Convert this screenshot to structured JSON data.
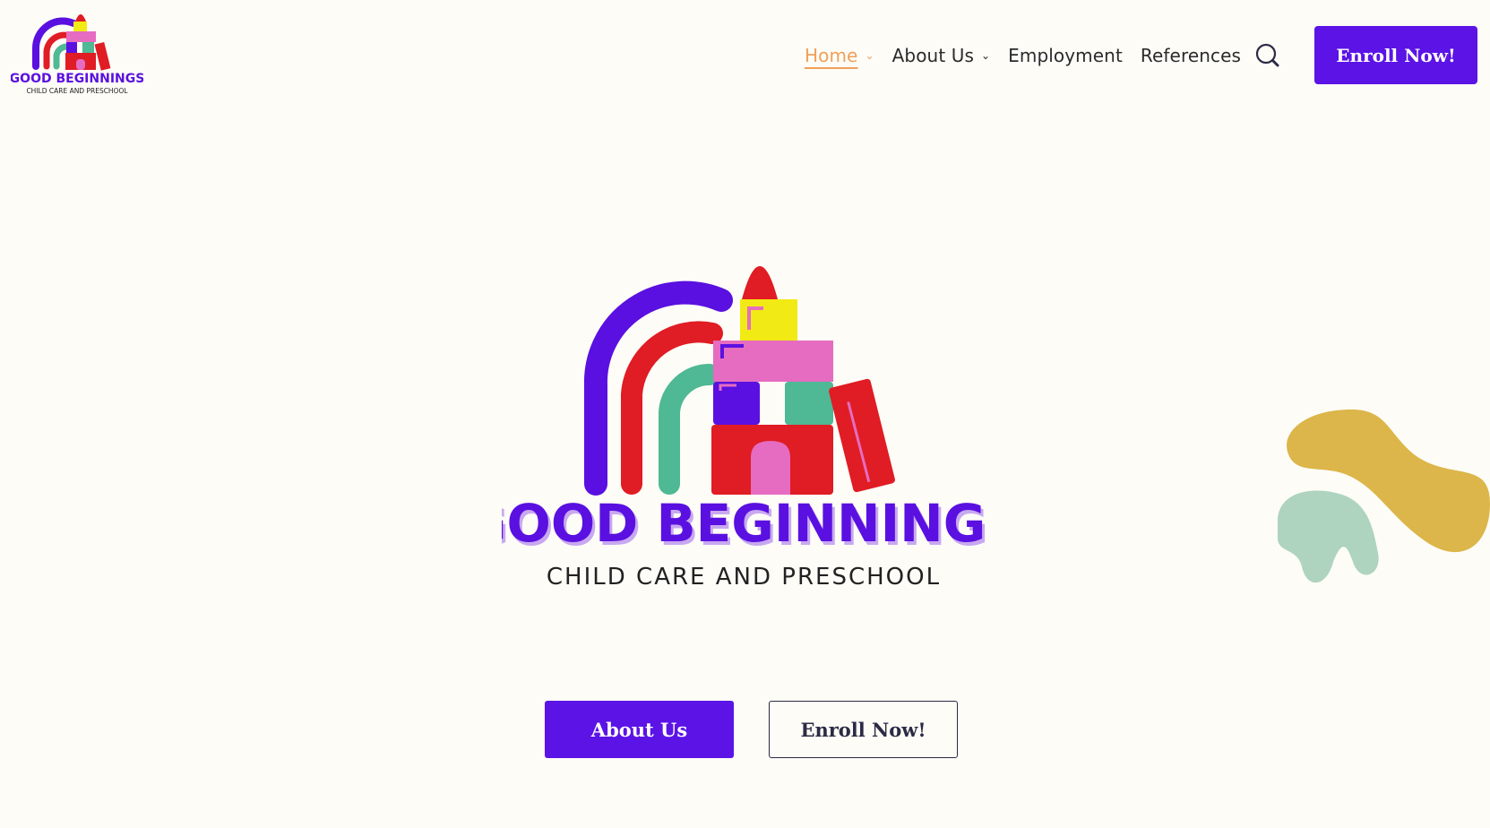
{
  "header": {
    "logo": {
      "title": "GOOD BEGINNINGS",
      "subtitle": "CHILD CARE AND PRESCHOOL"
    },
    "nav": [
      {
        "label": "Home",
        "active": true,
        "has_dropdown": true
      },
      {
        "label": "About Us",
        "active": false,
        "has_dropdown": true
      },
      {
        "label": "Employment",
        "active": false,
        "has_dropdown": false
      },
      {
        "label": "References",
        "active": false,
        "has_dropdown": false
      }
    ],
    "search_icon": "search-icon",
    "enroll_button": "Enroll Now!"
  },
  "hero": {
    "logo": {
      "title": "GOOD BEGINNINGS",
      "subtitle": "CHILD CARE AND PRESCHOOL"
    },
    "buttons": {
      "about": "About Us",
      "enroll": "Enroll Now!"
    }
  },
  "colors": {
    "background": "#fdfcf7",
    "primary": "#5b13e6",
    "accent_active": "#f0a05a",
    "text": "#2b2b2b",
    "blob_gold": "#dcb64a",
    "blob_mint": "#aed3bf",
    "logo_red": "#e01c24",
    "logo_purple": "#5a10e0",
    "logo_green": "#4fb894",
    "logo_pink": "#e56cc0",
    "logo_yellow": "#f2ea14"
  }
}
